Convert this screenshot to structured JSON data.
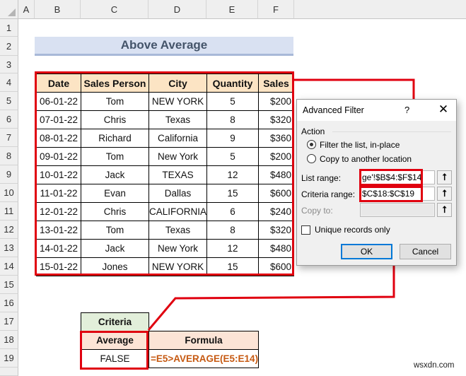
{
  "spreadsheet": {
    "columns": [
      "A",
      "B",
      "C",
      "D",
      "E",
      "F"
    ],
    "rows": [
      "1",
      "2",
      "3",
      "4",
      "5",
      "6",
      "7",
      "8",
      "9",
      "10",
      "11",
      "12",
      "13",
      "14",
      "15",
      "16",
      "17",
      "18",
      "19"
    ],
    "title": "Above Average",
    "table": {
      "headers": [
        "Date",
        "Sales Person",
        "City",
        "Quantity",
        "Sales"
      ],
      "rows": [
        [
          "06-01-22",
          "Tom",
          "NEW YORK",
          "5",
          "$200"
        ],
        [
          "07-01-22",
          "Chris",
          "Texas",
          "8",
          "$320"
        ],
        [
          "08-01-22",
          "Richard",
          "California",
          "9",
          "$360"
        ],
        [
          "09-01-22",
          "Tom",
          "New York",
          "5",
          "$200"
        ],
        [
          "10-01-22",
          "Jack",
          "TEXAS",
          "12",
          "$480"
        ],
        [
          "11-01-22",
          "Evan",
          "Dallas",
          "15",
          "$600"
        ],
        [
          "12-01-22",
          "Chris",
          "CALIFORNIA",
          "6",
          "$240"
        ],
        [
          "13-01-22",
          "Tom",
          "Texas",
          "8",
          "$320"
        ],
        [
          "14-01-22",
          "Jack",
          "New York",
          "12",
          "$480"
        ],
        [
          "15-01-22",
          "Jones",
          "NEW YORK",
          "15",
          "$600"
        ]
      ]
    },
    "criteria": {
      "title": "Criteria",
      "header": "Average",
      "value": "FALSE",
      "formula_header": "Formula",
      "formula": "=E5>AVERAGE(E5:E14)"
    }
  },
  "dialog": {
    "title": "Advanced Filter",
    "help": "?",
    "close": "✕",
    "action_label": "Action",
    "radio_filter_in_place": {
      "label": "Filter the list, in-place",
      "selected": true
    },
    "radio_copy_to_location": {
      "label": "Copy to another location",
      "selected": false
    },
    "list_range_label": "List range:",
    "list_range_value": "ge'!$B$4:$F$14",
    "criteria_range_label": "Criteria range:",
    "criteria_range_value": "$C$18:$C$19",
    "copy_to_label": "Copy to:",
    "copy_to_value": "",
    "unique_records_label": "Unique records only",
    "unique_records_checked": false,
    "ok_label": "OK",
    "cancel_label": "Cancel",
    "collapse_icon": "⭡"
  },
  "watermark": "wsxdn.com",
  "colors": {
    "highlight": "#e0000f",
    "table_header": "#fce4c4",
    "title_band": "#d9e1f2",
    "criteria_header": "#e2efda",
    "formula_text": "#c65911"
  }
}
